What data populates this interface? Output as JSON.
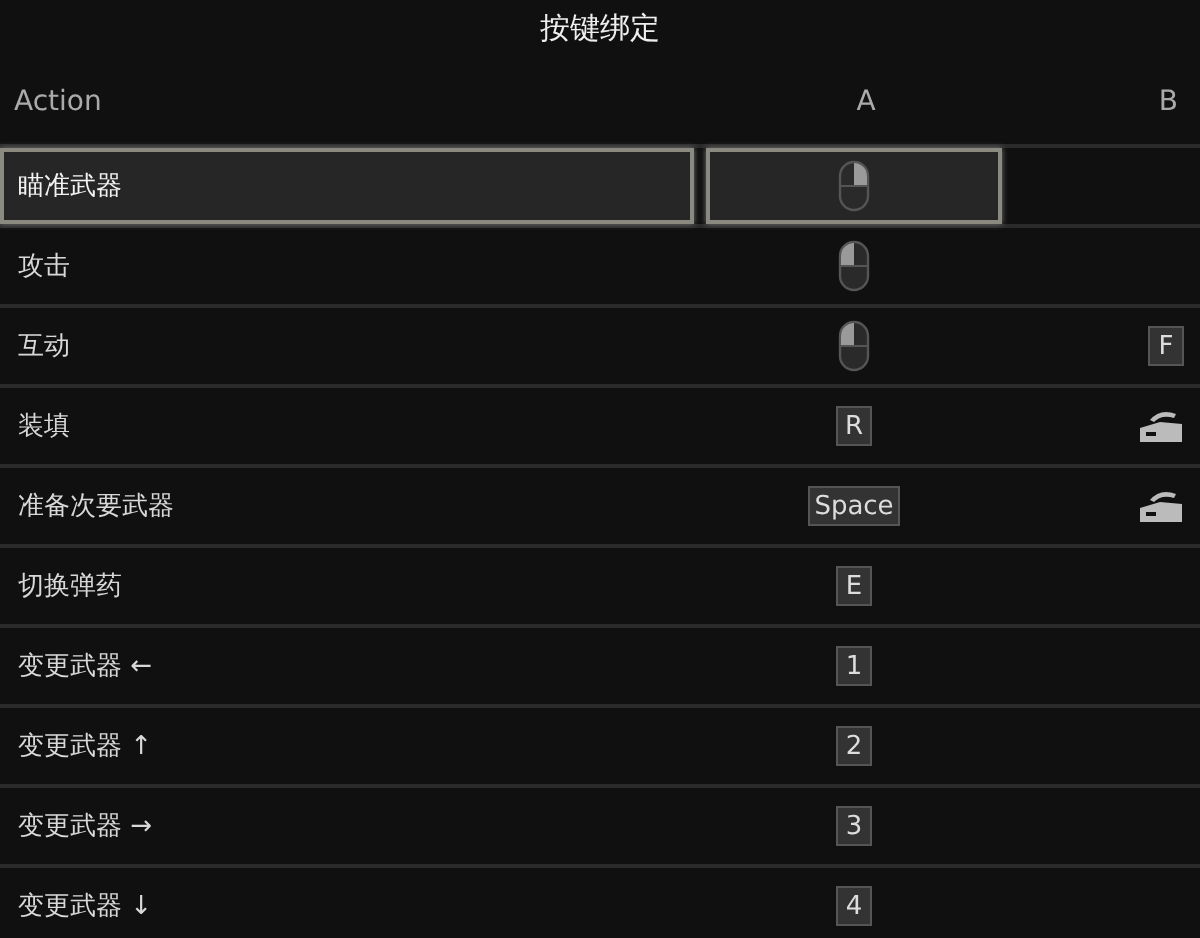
{
  "title": "按键绑定",
  "columns": [
    "Action",
    "A",
    "B"
  ],
  "rows": [
    {
      "action": "瞄准武器",
      "selected": true,
      "a": {
        "kind": "mouse-right"
      }
    },
    {
      "action": "攻击",
      "selected": false,
      "a": {
        "kind": "mouse-left"
      }
    },
    {
      "action": "互动",
      "selected": false,
      "a": {
        "kind": "mouse-left"
      },
      "b": {
        "kind": "key",
        "label": "F"
      }
    },
    {
      "action": "装填",
      "selected": false,
      "a": {
        "kind": "key",
        "label": "R"
      },
      "b": {
        "kind": "trigger"
      }
    },
    {
      "action": "准备次要武器",
      "selected": false,
      "a": {
        "kind": "key",
        "label": "Space"
      },
      "b": {
        "kind": "trigger"
      }
    },
    {
      "action": "切换弹药",
      "selected": false,
      "a": {
        "kind": "key",
        "label": "E"
      }
    },
    {
      "action": "变更武器 ←",
      "selected": false,
      "a": {
        "kind": "key",
        "label": "1"
      }
    },
    {
      "action": "变更武器 ↑",
      "selected": false,
      "a": {
        "kind": "key",
        "label": "2"
      }
    },
    {
      "action": "变更武器 →",
      "selected": false,
      "a": {
        "kind": "key",
        "label": "3"
      }
    },
    {
      "action": "变更武器 ↓",
      "selected": false,
      "a": {
        "kind": "key",
        "label": "4"
      }
    }
  ]
}
